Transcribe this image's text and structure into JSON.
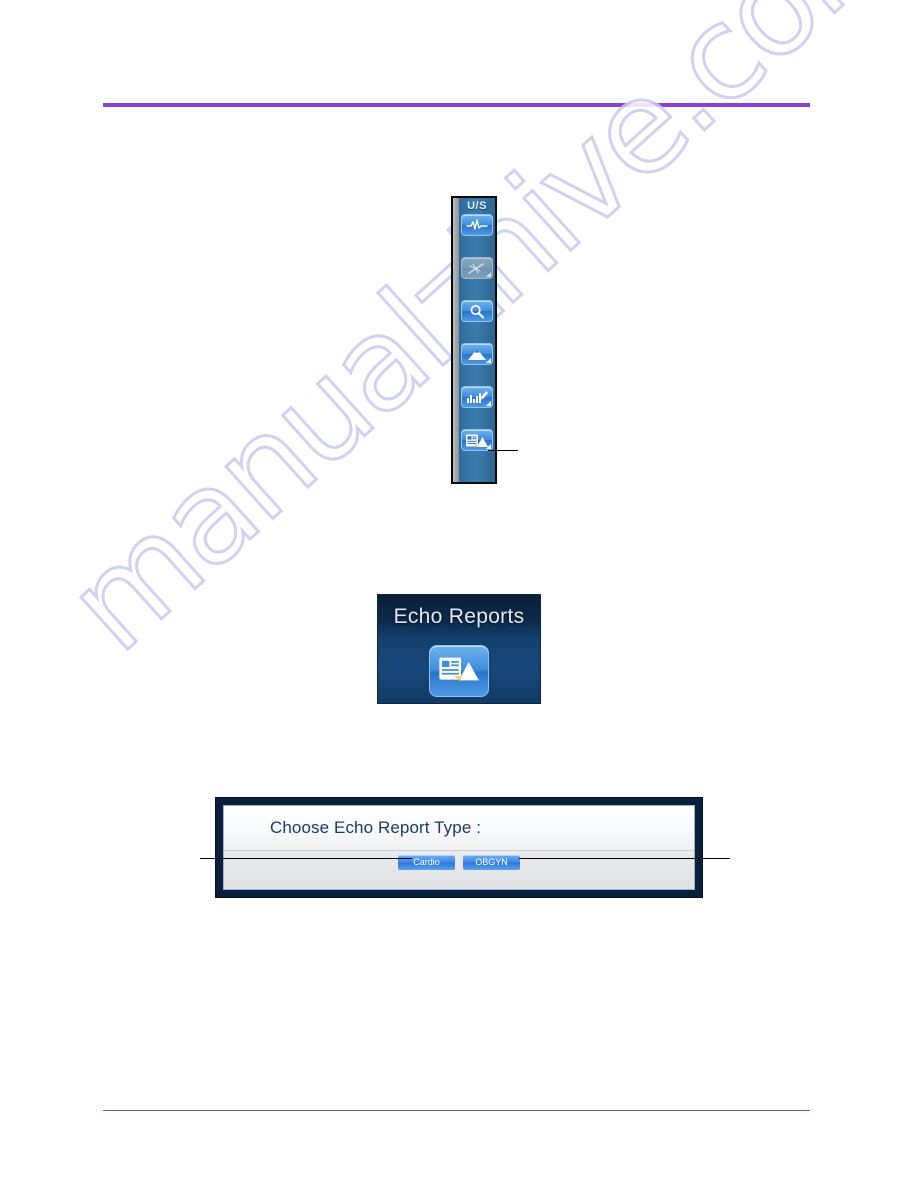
{
  "page": {
    "watermark": "manualzhive.com",
    "rule_color_top": "#8a3fdb",
    "rule_color_bottom": "#7a4ba0"
  },
  "toolbar": {
    "name": "ultrasound-mode-toolbar",
    "label": "U/S",
    "items": [
      {
        "id": "ecg-trace",
        "icon": "ecg-waveform-icon",
        "label": "ECG",
        "state": "enabled"
      },
      {
        "id": "needle-guide",
        "icon": "needle-guide-icon",
        "label": "Needle Guide",
        "state": "disabled"
      },
      {
        "id": "review",
        "icon": "magnifier-icon",
        "label": "Review",
        "state": "enabled"
      },
      {
        "id": "measurements",
        "icon": "triangle-measure-icon",
        "label": "Measurements",
        "state": "enabled"
      },
      {
        "id": "calc-worksheet",
        "icon": "chart-pencil-icon",
        "label": "Calc Worksheet",
        "state": "enabled"
      },
      {
        "id": "echo-reports",
        "icon": "echo-report-icon",
        "label": "Echo Reports",
        "state": "enabled"
      }
    ]
  },
  "echo_card": {
    "title": "Echo Reports",
    "icon": "echo-report-icon"
  },
  "dialog": {
    "title": "Choose Echo Report Type :",
    "options": [
      {
        "id": "cardio",
        "label": "Cardio"
      },
      {
        "id": "obgyn",
        "label": "OBGYN"
      }
    ]
  }
}
